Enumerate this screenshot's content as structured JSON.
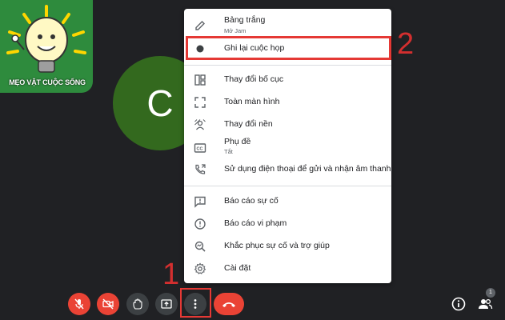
{
  "logo": {
    "text": "MẸO VẶT CUỘC SỐNG"
  },
  "avatar": {
    "initial": "C"
  },
  "menu": {
    "items": [
      {
        "label": "Bảng trắng",
        "sub": "Mở Jam",
        "icon": "pen-icon"
      },
      {
        "label": "Ghi lại cuộc họp",
        "icon": "record-dot-icon"
      },
      {
        "label": "Thay đổi bố cục",
        "icon": "layout-icon"
      },
      {
        "label": "Toàn màn hình",
        "icon": "fullscreen-icon"
      },
      {
        "label": "Thay đổi nền",
        "icon": "background-icon"
      },
      {
        "label": "Phụ đề",
        "sub": "Tắt",
        "icon": "captions-icon"
      },
      {
        "label": "Sử dụng điện thoại để gửi và nhận âm thanh",
        "icon": "phone-audio-icon"
      },
      {
        "label": "Báo cáo sự cố",
        "icon": "report-problem-icon"
      },
      {
        "label": "Báo cáo vi phạm",
        "icon": "report-abuse-icon"
      },
      {
        "label": "Khắc phục sự cố và trợ giúp",
        "icon": "troubleshoot-icon"
      },
      {
        "label": "Cài đặt",
        "icon": "gear-icon"
      }
    ]
  },
  "annotations": {
    "step1": "1",
    "step2": "2"
  },
  "participants": {
    "count": "1"
  },
  "colors": {
    "highlight": "#e53935",
    "end_call": "#ea4335",
    "avatar": "#33691e"
  }
}
